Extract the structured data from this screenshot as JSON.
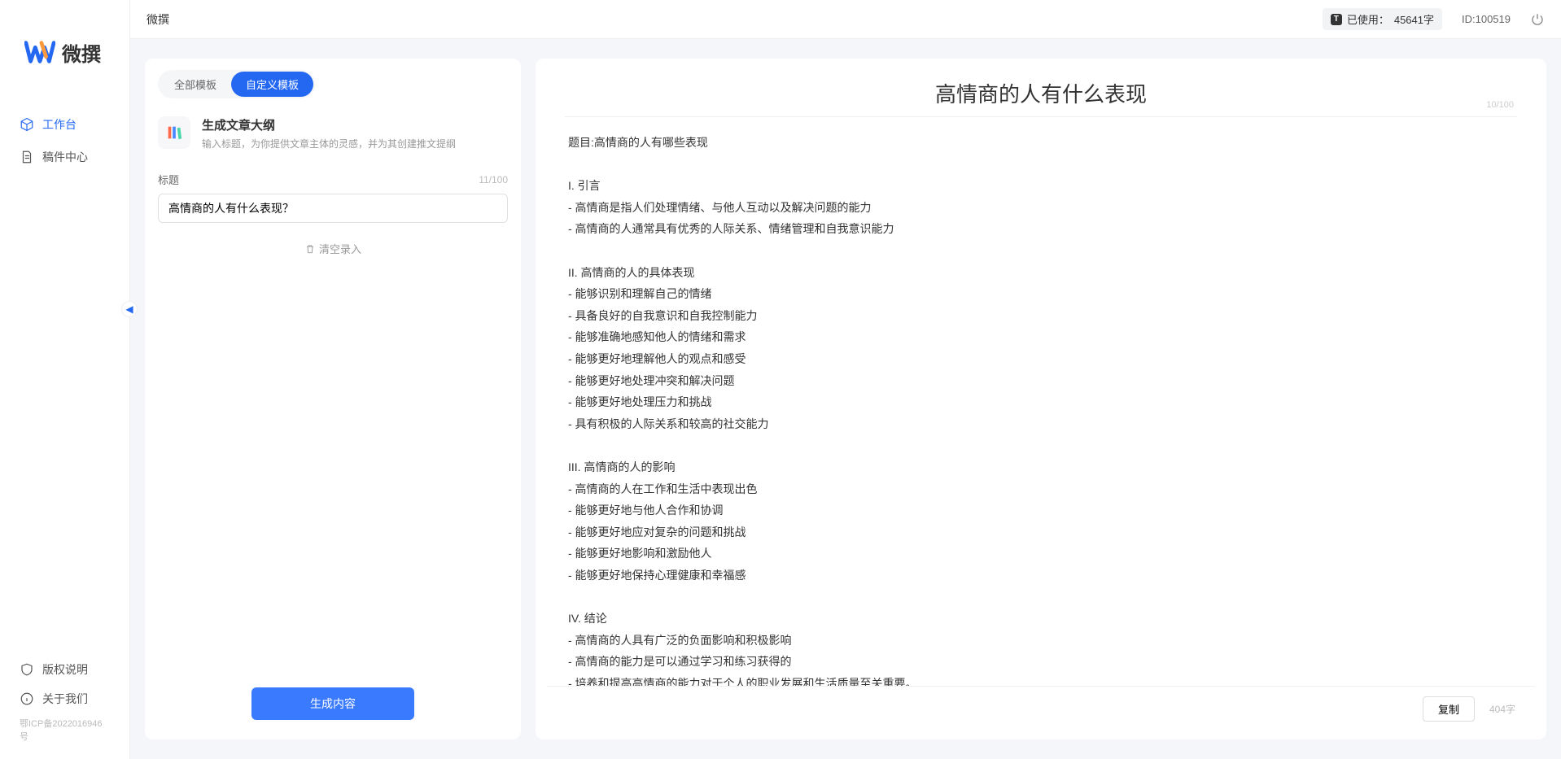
{
  "app": {
    "name": "微撰"
  },
  "sidebar": {
    "nav": {
      "workspace": "工作台",
      "drafts": "稿件中心"
    },
    "bottom": {
      "copyright": "版权说明",
      "about": "关于我们"
    },
    "icp": "鄂ICP备2022016946号"
  },
  "topbar": {
    "title": "微撰",
    "usage_label": "已使用：",
    "usage_value": "45641字",
    "user_id": "ID:100519"
  },
  "left_panel": {
    "tabs": {
      "all": "全部模板",
      "custom": "自定义模板"
    },
    "template": {
      "title": "生成文章大纲",
      "desc": "输入标题，为你提供文章主体的灵感，并为其创建推文提纲"
    },
    "form": {
      "title_label": "标题",
      "char_counter": "11/100",
      "title_value": "高情商的人有什么表现？",
      "clear_label": "清空录入"
    },
    "generate_btn": "生成内容"
  },
  "right_panel": {
    "title": "高情商的人有什么表现",
    "title_counter": "10/100",
    "body": "题目:高情商的人有哪些表现\n\nI. 引言\n- 高情商是指人们处理情绪、与他人互动以及解决问题的能力\n- 高情商的人通常具有优秀的人际关系、情绪管理和自我意识能力\n\nII. 高情商的人的具体表现\n- 能够识别和理解自己的情绪\n- 具备良好的自我意识和自我控制能力\n- 能够准确地感知他人的情绪和需求\n- 能够更好地理解他人的观点和感受\n- 能够更好地处理冲突和解决问题\n- 能够更好地处理压力和挑战\n- 具有积极的人际关系和较高的社交能力\n\nIII. 高情商的人的影响\n- 高情商的人在工作和生活中表现出色\n- 能够更好地与他人合作和协调\n- 能够更好地应对复杂的问题和挑战\n- 能够更好地影响和激励他人\n- 能够更好地保持心理健康和幸福感\n\nIV. 结论\n- 高情商的人具有广泛的负面影响和积极影响\n- 高情商的能力是可以通过学习和练习获得的\n- 培养和提高高情商的能力对于个人的职业发展和生活质量至关重要。",
    "copy_btn": "复制",
    "word_count": "404字"
  }
}
